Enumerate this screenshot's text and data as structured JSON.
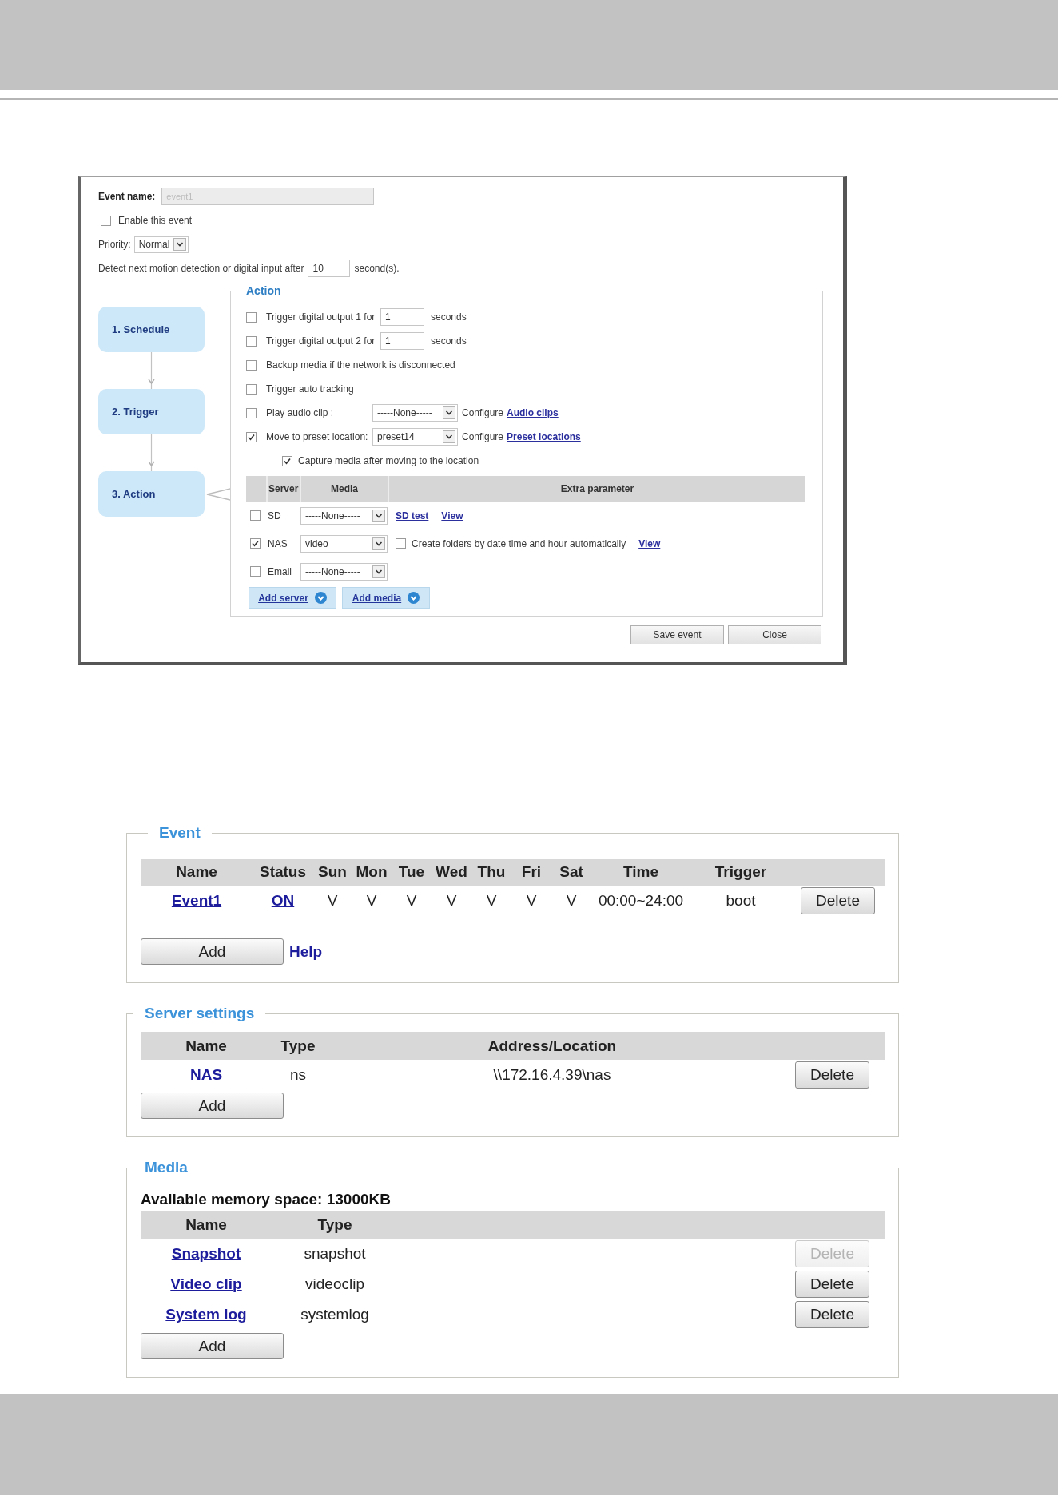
{
  "dialog": {
    "event_name": {
      "label": "Event name:",
      "value": "event1",
      "disabled": true
    },
    "enable_event": {
      "label": "Enable this event",
      "checked": false
    },
    "priority": {
      "label": "Priority:",
      "value": "Normal"
    },
    "detect_delay": {
      "text": "Detect next motion detection or digital input after",
      "value": "10",
      "unit": "second(s)."
    },
    "steps": [
      {
        "label": "1. Schedule"
      },
      {
        "label": "2. Trigger"
      },
      {
        "label": "3. Action"
      }
    ],
    "action": {
      "legend": "Action",
      "options": [
        {
          "kind": "input",
          "label": "Trigger digital output 1 for",
          "checked": false,
          "value": "1",
          "unit": "seconds"
        },
        {
          "kind": "input",
          "label": "Trigger digital output 2 for",
          "checked": false,
          "value": "1",
          "unit": "seconds"
        },
        {
          "kind": "plain",
          "label": "Backup media if the network is disconnected",
          "checked": false
        },
        {
          "kind": "plain",
          "label": "Trigger auto tracking",
          "checked": false
        },
        {
          "kind": "select",
          "label": "Play audio clip :",
          "checked": false,
          "value": "-----None-----",
          "configure": "Configure",
          "link": "Audio clips"
        },
        {
          "kind": "select",
          "label": "Move to preset location:",
          "checked": true,
          "value": "preset14",
          "configure": "Configure",
          "link": "Preset locations"
        },
        {
          "kind": "sub",
          "label": "Capture media after moving to the location",
          "checked": true
        }
      ],
      "table": {
        "columns": [
          "Server",
          "Media",
          "Extra parameter"
        ],
        "rows": [
          {
            "checked": false,
            "server": "SD",
            "media": "-----None-----",
            "extra": [
              {
                "kind": "link",
                "text": "SD test"
              },
              {
                "kind": "link",
                "text": "View"
              }
            ]
          },
          {
            "checked": true,
            "server": "NAS",
            "media": "video",
            "extra": [
              {
                "kind": "checkbox",
                "text": "Create folders by date time and hour automatically",
                "checked": false
              },
              {
                "kind": "link",
                "text": "View"
              }
            ]
          },
          {
            "checked": false,
            "server": "Email",
            "media": "-----None-----"
          }
        ]
      },
      "add_buttons": [
        "Add server",
        "Add media"
      ]
    },
    "buttons": [
      "Save event",
      "Close"
    ]
  },
  "event": {
    "legend": "Event",
    "columns": [
      "Name",
      "Status",
      "Sun",
      "Mon",
      "Tue",
      "Wed",
      "Thu",
      "Fri",
      "Sat",
      "Time",
      "Trigger"
    ],
    "rows": [
      {
        "cells": [
          {
            "kind": "link",
            "text": "Event1"
          },
          {
            "kind": "link",
            "text": "ON"
          },
          {
            "kind": "text",
            "text": "V"
          },
          {
            "kind": "text",
            "text": "V"
          },
          {
            "kind": "text",
            "text": "V"
          },
          {
            "kind": "text",
            "text": "V"
          },
          {
            "kind": "text",
            "text": "V"
          },
          {
            "kind": "text",
            "text": "V"
          },
          {
            "kind": "text",
            "text": "V"
          },
          {
            "kind": "text",
            "text": "00:00~24:00"
          },
          {
            "kind": "text",
            "text": "boot"
          }
        ],
        "delete_button": {
          "label": "Delete",
          "disabled": false
        }
      }
    ],
    "add": "Add",
    "help": "Help"
  },
  "server_settings": {
    "legend": "Server settings",
    "columns": [
      "Name",
      "Type",
      "Address/Location"
    ],
    "rows": [
      {
        "cells": [
          {
            "kind": "link",
            "text": "NAS"
          },
          {
            "kind": "text",
            "text": "ns"
          },
          {
            "kind": "text",
            "text": "\\\\172.16.4.39\\nas"
          }
        ],
        "delete_button": {
          "label": "Delete",
          "disabled": false
        }
      }
    ],
    "add": "Add"
  },
  "media": {
    "legend": "Media",
    "memory": "Available memory space: 13000KB",
    "columns": [
      "Name",
      "Type"
    ],
    "rows": [
      {
        "cells": [
          {
            "kind": "link",
            "text": "Snapshot"
          },
          {
            "kind": "text",
            "text": "snapshot"
          }
        ],
        "delete_button": {
          "label": "Delete",
          "disabled": true
        }
      },
      {
        "cells": [
          {
            "kind": "link",
            "text": "Video clip"
          },
          {
            "kind": "text",
            "text": "videoclip"
          }
        ],
        "delete_button": {
          "label": "Delete",
          "disabled": false
        }
      },
      {
        "cells": [
          {
            "kind": "link",
            "text": "System log"
          },
          {
            "kind": "text",
            "text": "systemlog"
          }
        ],
        "delete_button": {
          "label": "Delete",
          "disabled": false
        }
      }
    ],
    "add": "Add"
  }
}
